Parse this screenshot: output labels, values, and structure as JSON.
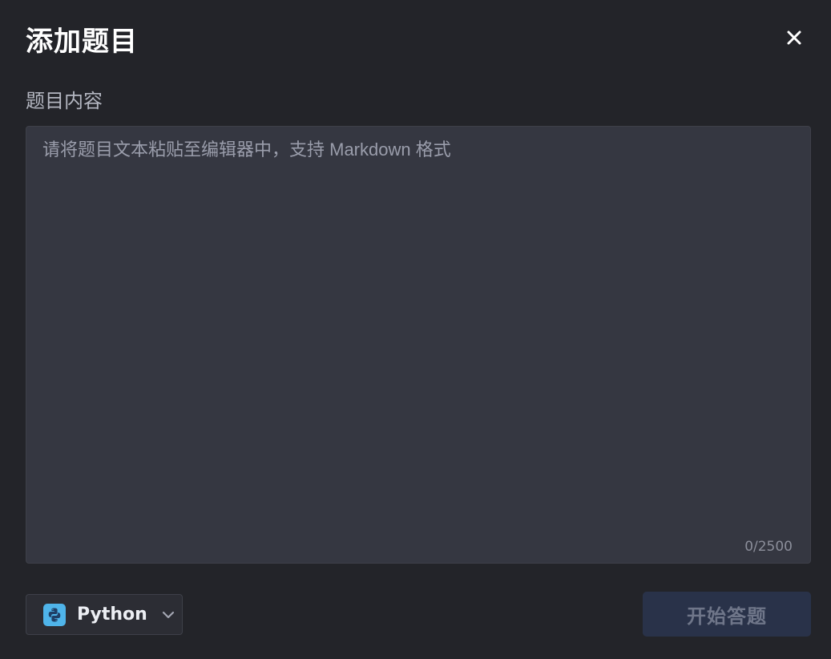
{
  "dialog": {
    "title": "添加题目",
    "close_icon": "close-icon"
  },
  "content_field": {
    "label": "题目内容",
    "value": "",
    "placeholder": "请将题目文本粘贴至编辑器中，支持 Markdown 格式",
    "char_count": "0/2500"
  },
  "language_select": {
    "icon": "python-icon",
    "selected": "Python",
    "chevron_icon": "chevron-down-icon"
  },
  "start_button": {
    "label": "开始答题",
    "disabled": true
  },
  "colors": {
    "background": "#232429",
    "editor_background": "#353741",
    "python_icon_bg": "#4fb4ea",
    "start_button_bg": "#293249",
    "start_button_text": "#6f7689"
  }
}
